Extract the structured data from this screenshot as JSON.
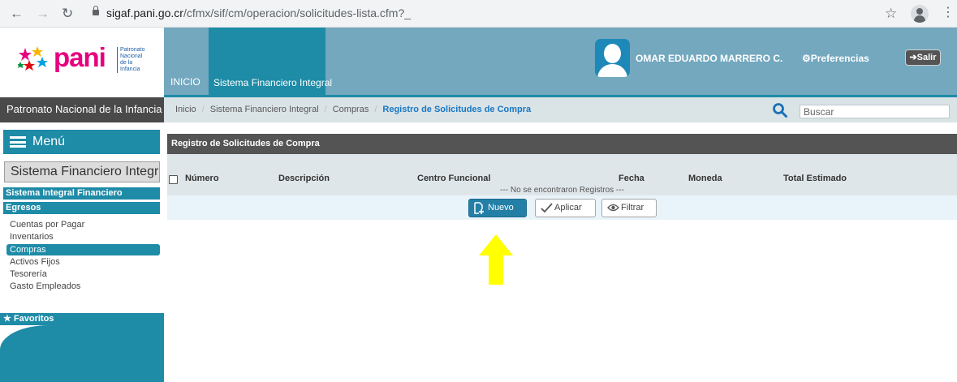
{
  "browser": {
    "url_host": "sigaf.pani.go.cr",
    "url_path": "/cfmx/sif/cm/operacion/solicitudes-lista.cfm?_"
  },
  "header": {
    "logo_text": "pani",
    "logo_subtitle": "Patronato Nacional de la Infancia",
    "tabs": [
      {
        "label": "INICIO"
      },
      {
        "label": "Sistema Financiero Integral"
      }
    ],
    "user_name": "OMAR EDUARDO MARRERO C.",
    "preferences_label": "⚙Preferencias",
    "logout_label": "➔Salir"
  },
  "org_title": "Patronato Nacional de la Infancia",
  "breadcrumb": {
    "items": [
      "Inicio",
      "Sistema Financiero Integral",
      "Compras"
    ],
    "current": "Registro de Solicitudes de Compra"
  },
  "search": {
    "placeholder": "Buscar"
  },
  "sidebar": {
    "menu_label": "Menú",
    "module": "Sistema Financiero Integral",
    "section1": "Sistema Integral Financiero",
    "section2": "Egresos",
    "items": [
      {
        "label": "Cuentas por Pagar"
      },
      {
        "label": "Inventarios"
      },
      {
        "label": "Compras",
        "active": true
      },
      {
        "label": "Activos Fijos"
      },
      {
        "label": "Tesorería"
      },
      {
        "label": "Gasto Empleados"
      }
    ],
    "favorites_label": "★ Favoritos"
  },
  "main": {
    "panel_title": "Registro de Solicitudes de Compra",
    "columns": [
      "Número",
      "Descripción",
      "Centro Funcional",
      "Fecha",
      "Moneda",
      "Total Estimado"
    ],
    "empty_message": "--- No se encontraron Registros ---",
    "buttons": {
      "nuevo": "Nuevo",
      "aplicar": "Aplicar",
      "filtrar": "Filtrar"
    }
  },
  "colors": {
    "primary_teal": "#1e8ba7",
    "header_blue": "#73a8bf",
    "dark_gray": "#545454",
    "annotation_arrow": "#ffff00",
    "logo_magenta": "#e6007e"
  }
}
